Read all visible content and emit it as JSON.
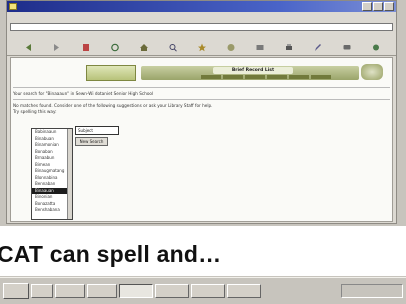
{
  "caption": {
    "text": "CAT can spell and…"
  },
  "content": {
    "banner_title": "Brief Record List",
    "para1": "Your search for \"Binaaaun\" in Sewn-Wi dotaniet Senior High School",
    "para2": "No matches found. Consider one of the following suggestions or ask your Library Staff for help.",
    "para3": "Try spelling this way:",
    "input_value": "Subject",
    "go_label": "New Search",
    "listbox_items": [
      "Babinaaun",
      "Binabuan",
      "Binamonian",
      "Bonaban",
      "Brnaabun",
      "Bimean",
      "Binaugmatang",
      "Blonnabina",
      "Bennaban",
      "Binaauan",
      "Binonian",
      "Bonazatta",
      "Benshabana"
    ],
    "selected_index": 9
  }
}
